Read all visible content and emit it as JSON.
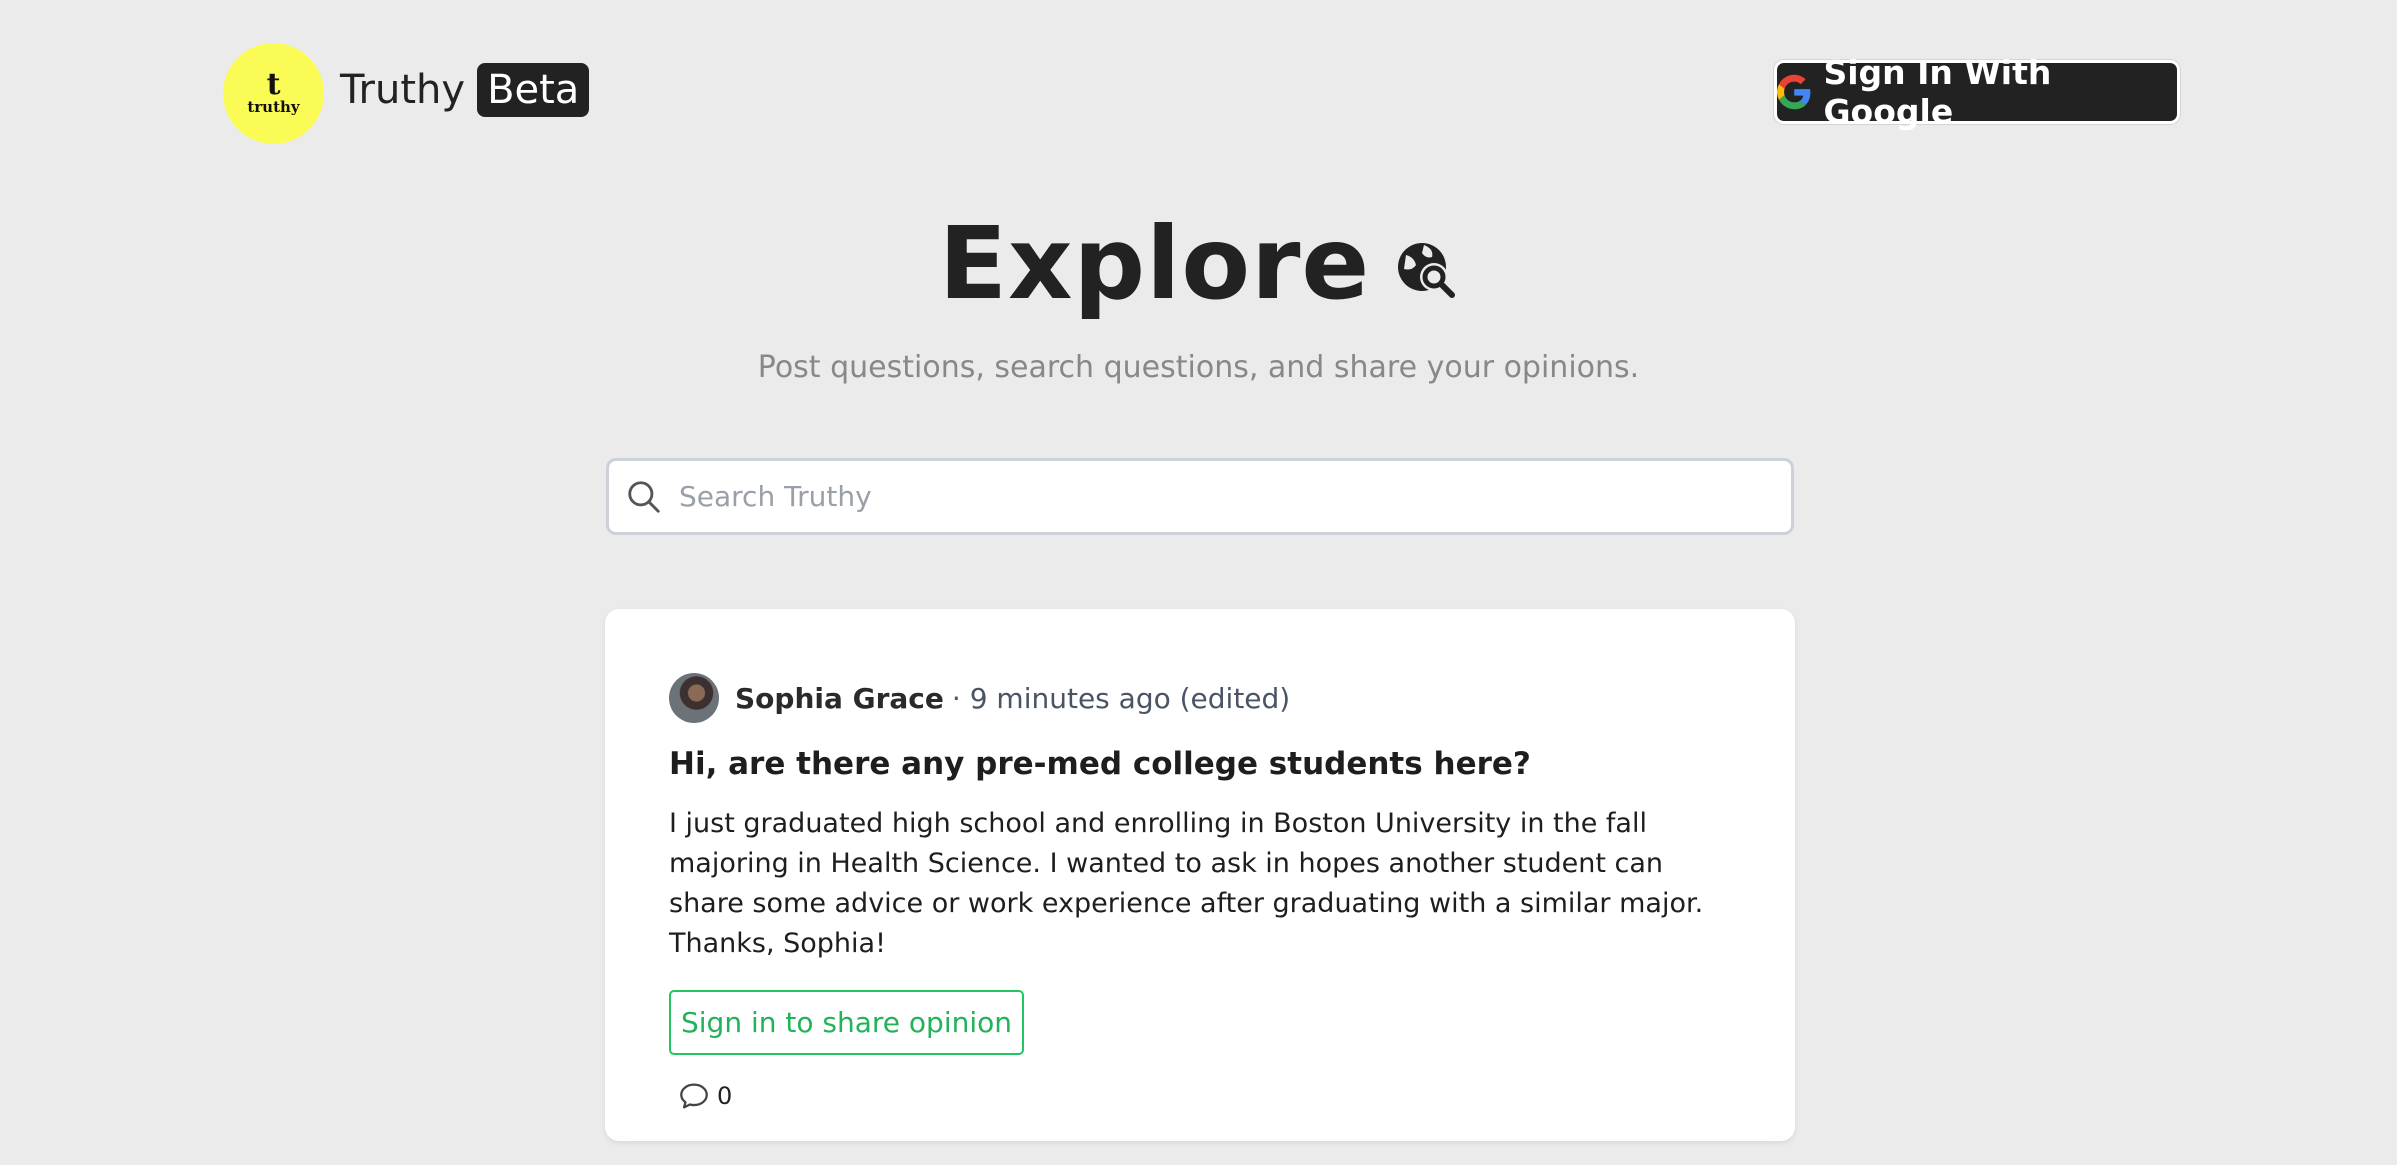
{
  "header": {
    "logo_glyph": "t",
    "logo_word": "truthy",
    "brand_name": "Truthy",
    "beta_label": "Beta",
    "signin_label": "Sign In With Google"
  },
  "hero": {
    "title": "Explore",
    "subtitle": "Post questions, search questions, and share your opinions."
  },
  "search": {
    "placeholder": "Search Truthy",
    "value": ""
  },
  "post": {
    "author": "Sophia Grace",
    "time": "· 9 minutes ago (edited)",
    "title": "Hi, are there any pre-med college students here?",
    "body": "I just graduated high school and enrolling in Boston University in the fall majoring in Health Science. I wanted to ask in hopes another student can share some advice or work experience after graduating with a similar major. Thanks, Sophia!",
    "opinion_button": "Sign in to share opinion",
    "comment_count": "0"
  },
  "colors": {
    "background": "#ebebeb",
    "logo_yellow": "#fbfb55",
    "dark": "#222222",
    "green_accent": "#22c463"
  },
  "icons": [
    "google-icon",
    "explore-globe-search-icon",
    "search-icon",
    "comment-icon"
  ]
}
